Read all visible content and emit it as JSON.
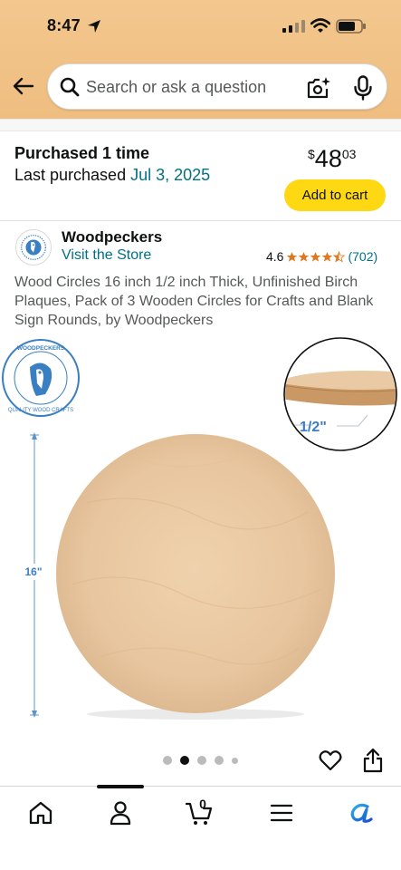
{
  "status_bar": {
    "time": "8:47"
  },
  "search": {
    "placeholder": "Search or ask a question"
  },
  "purchase": {
    "line1": "Purchased 1 time",
    "line2_prefix": "Last purchased ",
    "date": "Jul 3, 2025",
    "price_symbol": "$",
    "price_whole": "48",
    "price_fraction": "03",
    "add_to_cart_label": "Add to cart"
  },
  "brand": {
    "name": "Woodpeckers",
    "visit_label": "Visit the Store",
    "rating": "4.6",
    "rating_value": 4.6,
    "review_count": "(702)"
  },
  "product": {
    "title": "Wood Circles 16 inch 1/2 inch Thick, Unfinished Birch Plaques, Pack of 3 Wooden Circles for Crafts and Blank Sign Rounds, by Woodpeckers",
    "image": {
      "thickness_label": "1/2\"",
      "diameter_label": "16\"",
      "seal_text": "WOODPECKERS · QUALITY WOOD CRAFTS"
    }
  },
  "carousel": {
    "image_count": 5,
    "active_index": 1
  },
  "bottom_nav": {
    "items": [
      "home-icon",
      "account-icon",
      "cart-icon",
      "menu-icon",
      "rufus-icon"
    ],
    "cart_count": "0"
  },
  "colors": {
    "header": "#efbd80",
    "link": "#007185",
    "cart_button": "#ffd814",
    "star": "#de7921",
    "blue_accent": "#3a7fc1"
  }
}
